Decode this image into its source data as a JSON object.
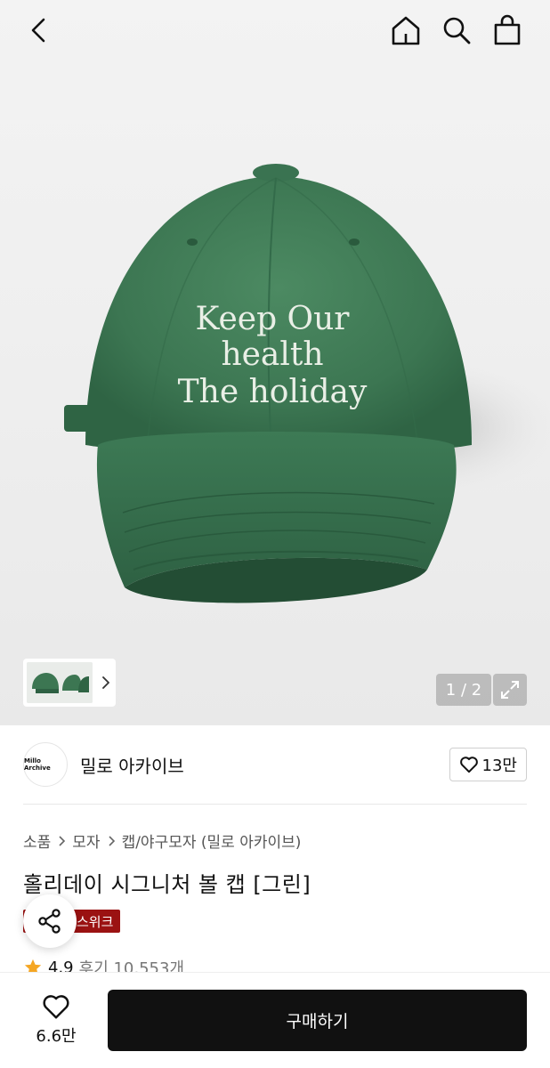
{
  "header": {
    "icons": [
      "back-arrow-icon",
      "home-icon",
      "search-icon",
      "shopping-bag-icon"
    ]
  },
  "hero": {
    "cap_embroidery": [
      "Keep Our",
      "health",
      "The holiday"
    ],
    "cap_color": "#3f7a55",
    "counter": "1 / 2"
  },
  "brand": {
    "logo_text": "Millo Archive",
    "name": "밀로 아카이브",
    "likes": "13만"
  },
  "breadcrumb": [
    "소품",
    "모자",
    "캡/야구모자 (밀로 아카이브)"
  ],
  "product": {
    "title": "홀리데이 시그니처 볼 캡 [그린]",
    "badge": "스위크",
    "rating": "4.9",
    "reviews": "후기 10,553개"
  },
  "bottom": {
    "wish_count": "6.6만",
    "buy_label": "구매하기"
  },
  "colors": {
    "accent_badge": "#9b1212",
    "buy_button": "#111111",
    "star": "#f5a623"
  }
}
